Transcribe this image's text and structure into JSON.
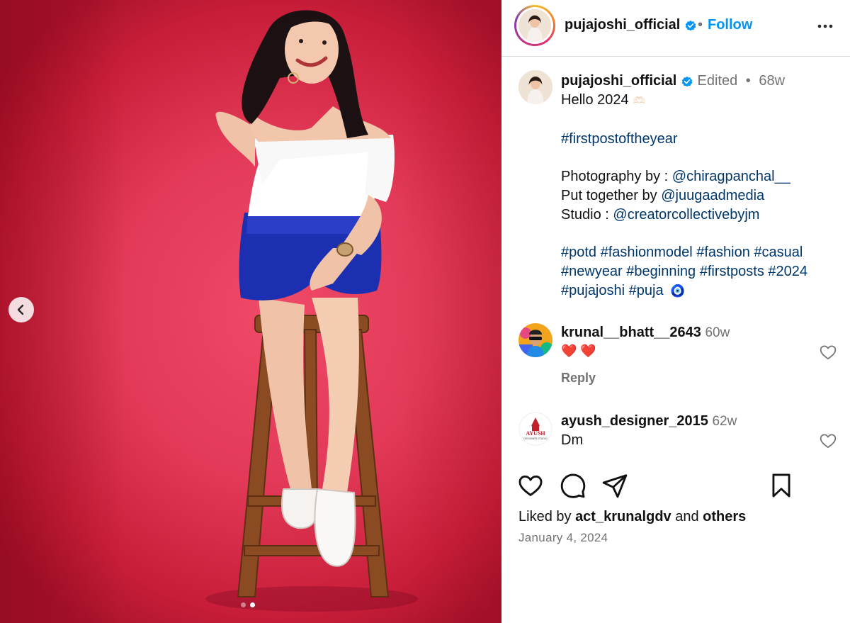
{
  "post": {
    "username": "pujajoshi_official",
    "follow_label": "Follow",
    "separator": "•",
    "more_icon": "more-horizontal-icon",
    "verified_color": "#0095f6"
  },
  "caption": {
    "username": "pujajoshi_official",
    "edited": "Edited",
    "dot": "•",
    "time": "68w",
    "line1": "Hello 2024",
    "line1_emoji": "🫶🏻",
    "hashtag_line": "#firstpostoftheyear",
    "photo_label": "Photography by : ",
    "photo_handle": "@chiragpanchal__",
    "put_label": "Put together by ",
    "put_handle": "@juugaadmedia",
    "studio_label": "Studio : ",
    "studio_handle": "@creatorcollectivebyjm",
    "tags_line1": "#potd #fashionmodel #fashion #casual",
    "tags_line2": "#newyear #beginning #firstposts #2024",
    "tags_line3": "#pujajoshi #puja",
    "tags_emoji": "🧿"
  },
  "comments": [
    {
      "username": "krunal__bhatt__2643",
      "time": "60w",
      "text": "❤️ ❤️",
      "reply": "Reply"
    },
    {
      "username": "ayush_designer_2015",
      "time": "62w",
      "text": "Dm"
    }
  ],
  "comment_avatar_text": {
    "brand": "AYUSH",
    "sub": "DESIGNER STUDIO"
  },
  "actions": {
    "like_icon": "heart-icon",
    "comment_icon": "comment-icon",
    "share_icon": "send-icon",
    "save_icon": "bookmark-icon"
  },
  "likes": {
    "prefix": "Liked by ",
    "user": "act_krunalgdv",
    "middle": " and ",
    "others": "others"
  },
  "date": "January 4, 2024",
  "carousel": {
    "total": 2,
    "active": 2
  },
  "colors": {
    "link": "#00376b",
    "accent": "#0095f6",
    "muted": "#737373",
    "backdrop": "#e23a58"
  }
}
